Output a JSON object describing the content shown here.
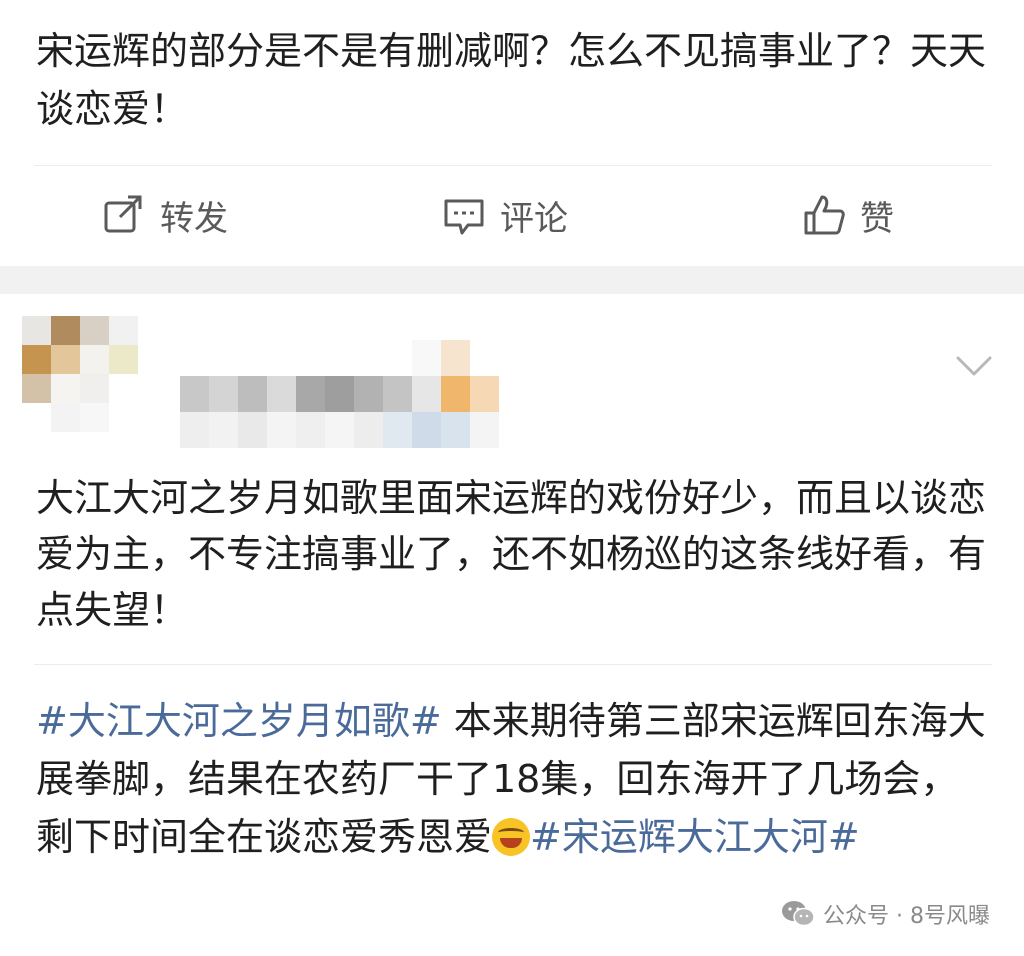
{
  "post": {
    "text": "宋运辉的部分是不是有删减啊？怎么不见搞事业了？天天谈恋爱！"
  },
  "actions": [
    {
      "icon": "share-icon",
      "label": "转发"
    },
    {
      "icon": "comment-icon",
      "label": "评论"
    },
    {
      "icon": "like-icon",
      "label": "赞"
    }
  ],
  "comment": {
    "body": "大江大河之岁月如歌里面宋运辉的戏份好少，而且以谈恋爱为主，不专注搞事业了，还不如杨巡的这条线好看，有点失望！",
    "quote_hashtag_1": "#大江大河之岁月如歌#",
    "quote_text": " 本来期待第三部宋运辉回东海大展拳脚，结果在农药厂干了18集，回东海开了几场会，剩下时间全在谈恋爱秀恩爱",
    "quote_hashtag_2": "#宋运辉大江大河#"
  },
  "watermark": {
    "text": "公众号 · 8号风曝",
    "icon": "wechat-icon"
  },
  "colors": {
    "hashtag": "#4a6b9a",
    "action_gray": "#5a5a5a",
    "band": "#f1f1f1"
  }
}
